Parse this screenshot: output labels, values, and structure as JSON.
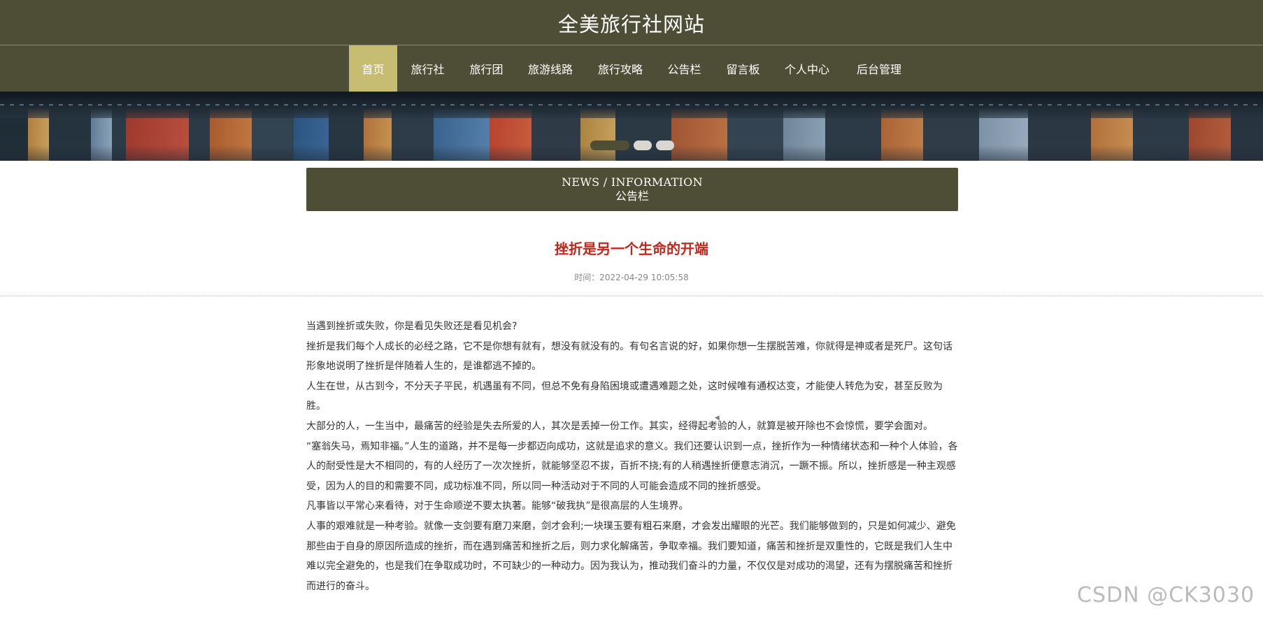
{
  "header": {
    "title": "全美旅行社网站"
  },
  "nav": {
    "items": [
      {
        "label": "首页",
        "active": true
      },
      {
        "label": "旅行社",
        "active": false
      },
      {
        "label": "旅行团",
        "active": false
      },
      {
        "label": "旅游线路",
        "active": false
      },
      {
        "label": "旅行攻略",
        "active": false
      },
      {
        "label": "公告栏",
        "active": false
      },
      {
        "label": "留言板",
        "active": false
      },
      {
        "label": "个人中心",
        "active": false
      },
      {
        "label": "后台管理",
        "active": false
      }
    ]
  },
  "carousel": {
    "slide_count": 3,
    "active_index": 0
  },
  "section": {
    "en": "NEWS / INFORMATION",
    "cn": "公告栏"
  },
  "article": {
    "title": "挫折是另一个生命的开端",
    "time": "时间：2022-04-29 10:05:58",
    "paragraphs": [
      "当遇到挫折或失败，你是看见失败还是看见机会?",
      "挫折是我们每个人成长的必经之路，它不是你想有就有，想没有就没有的。有句名言说的好，如果你想一生摆脱苦难，你就得是神或者是死尸。这句话形象地说明了挫折是伴随着人生的，是谁都逃不掉的。",
      "人生在世，从古到今，不分天子平民，机遇虽有不同，但总不免有身陷困境或遭遇难题之处，这时候唯有通权达变，才能使人转危为安，甚至反败为胜。",
      "大部分的人，一生当中，最痛苦的经验是失去所爱的人，其次是丢掉一份工作。其实，经得起考验的人，就算是被开除也不会惊慌，要学会面对。",
      "“塞翁失马，焉知非福。”人生的道路，并不是每一步都迈向成功，这就是追求的意义。我们还要认识到一点，挫折作为一种情绪状态和一种个人体验，各人的耐受性是大不相同的，有的人经历了一次次挫折，就能够坚忍不拔，百折不挠;有的人稍遇挫折便意志消沉，一蹶不振。所以，挫折感是一种主观感受，因为人的目的和需要不同，成功标准不同，所以同一种活动对于不同的人可能会造成不同的挫折感受。",
      "凡事皆以平常心来看待，对于生命顺逆不要太执著。能够“破我执”是很高层的人生境界。",
      "人事的艰难就是一种考验。就像一支剑要有磨刀来磨，剑才会利;一块璞玉要有粗石来磨，才会发出耀眼的光芒。我们能够做到的，只是如何减少、避免那些由于自身的原因所造成的挫折，而在遇到痛苦和挫折之后，则力求化解痛苦，争取幸福。我们要知道，痛苦和挫折是双重性的，它既是我们人生中难以完全避免的，也是我们在争取成功时，不可缺少的一种动力。因为我认为，推动我们奋斗的力量，不仅仅是对成功的渴望，还有为摆脱痛苦和挫折而进行的奋斗。"
    ]
  },
  "watermark": "CSDN @CK3030",
  "colors": {
    "header_bg": "#4e4e36",
    "nav_active_bg": "#c6bc72",
    "title_red": "#c0281e",
    "text": "#333333"
  }
}
